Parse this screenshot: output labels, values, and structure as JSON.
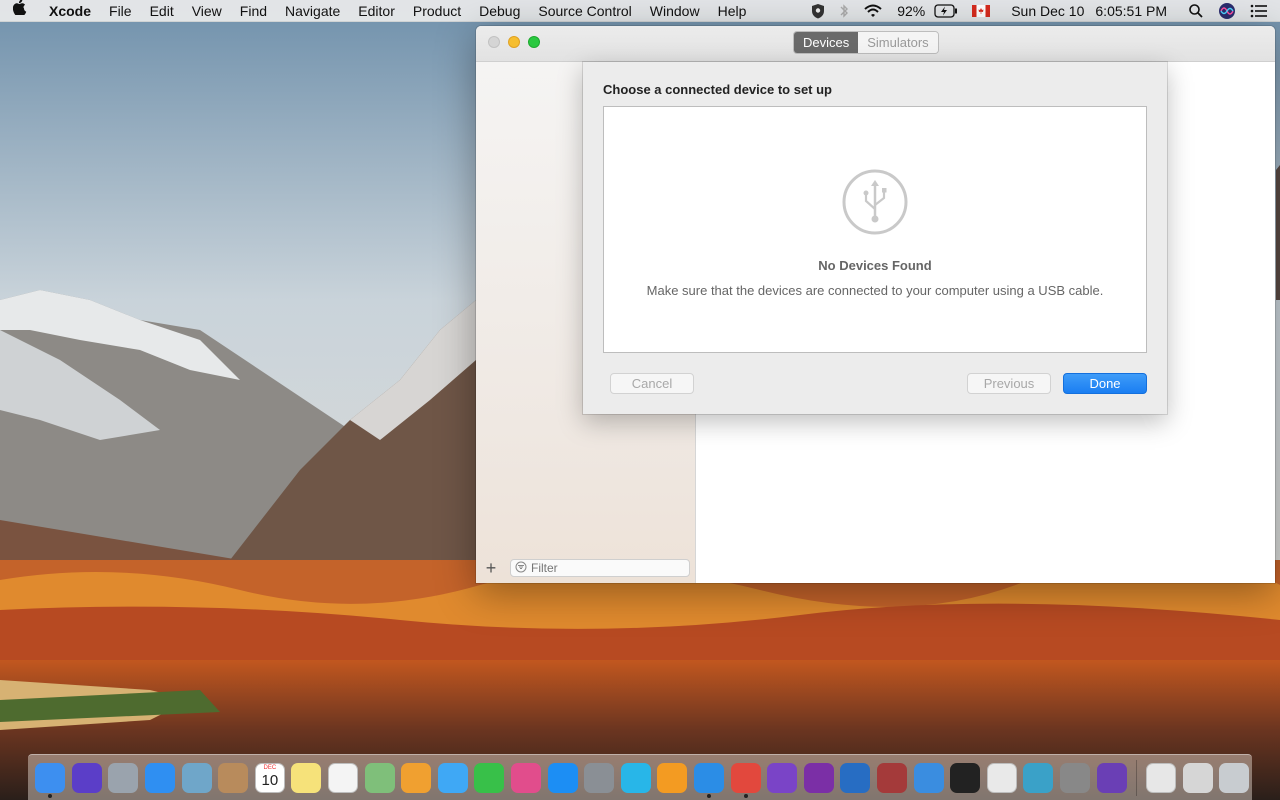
{
  "menubar": {
    "app_name": "Xcode",
    "items": [
      "File",
      "Edit",
      "View",
      "Find",
      "Navigate",
      "Editor",
      "Product",
      "Debug",
      "Source Control",
      "Window",
      "Help"
    ],
    "battery": "92%",
    "date": "Sun Dec 10",
    "time": "6:05:51 PM"
  },
  "window": {
    "tabs": [
      {
        "label": "Devices",
        "active": true
      },
      {
        "label": "Simulators",
        "active": false
      }
    ],
    "filter_placeholder": "Filter"
  },
  "sheet": {
    "title": "Choose a connected device to set up",
    "empty_title": "No Devices Found",
    "empty_message": "Make sure that the devices are connected to your computer using a USB cable.",
    "cancel_label": "Cancel",
    "previous_label": "Previous",
    "done_label": "Done"
  },
  "dock": {
    "calendar_day": "10",
    "calendar_month": "DEC",
    "items": [
      {
        "name": "finder",
        "color": "#3d8ff0"
      },
      {
        "name": "siri",
        "color": "#5b3ec8"
      },
      {
        "name": "launchpad",
        "color": "#9aa3ad"
      },
      {
        "name": "safari",
        "color": "#2f8ff2"
      },
      {
        "name": "preview",
        "color": "#6fa6c9"
      },
      {
        "name": "contacts",
        "color": "#b88b5c"
      },
      {
        "name": "calendar",
        "color": "#ffffff"
      },
      {
        "name": "notes",
        "color": "#f6e27a"
      },
      {
        "name": "reminders",
        "color": "#f4f4f4"
      },
      {
        "name": "maps",
        "color": "#7fbf7a"
      },
      {
        "name": "photos",
        "color": "#f0a030"
      },
      {
        "name": "messages",
        "color": "#3fa8f5"
      },
      {
        "name": "facetime",
        "color": "#38c049"
      },
      {
        "name": "itunes",
        "color": "#e14d8c"
      },
      {
        "name": "app-store",
        "color": "#1c8ef4"
      },
      {
        "name": "system-preferences",
        "color": "#8a8f95"
      },
      {
        "name": "network-app",
        "color": "#28b6e8"
      },
      {
        "name": "ibooks",
        "color": "#f39b22"
      },
      {
        "name": "xcode",
        "color": "#2b8de6"
      },
      {
        "name": "chrome",
        "color": "#e2483d"
      },
      {
        "name": "cinema",
        "color": "#7a44c7"
      },
      {
        "name": "onenote",
        "color": "#7b2fa6"
      },
      {
        "name": "r-app",
        "color": "#276dc3"
      },
      {
        "name": "dictionary",
        "color": "#a43a3a"
      },
      {
        "name": "instruments",
        "color": "#3a8de0"
      },
      {
        "name": "terminal",
        "color": "#222222"
      },
      {
        "name": "textedit",
        "color": "#e9e9e9"
      },
      {
        "name": "sketch-app",
        "color": "#3aa1c8"
      },
      {
        "name": "calculator",
        "color": "#888888"
      },
      {
        "name": "visual-studio",
        "color": "#6a3fb5"
      }
    ],
    "right_items": [
      {
        "name": "stacks-documents",
        "color": "#e7e7e7"
      },
      {
        "name": "stacks-downloads",
        "color": "#d6d6d6"
      },
      {
        "name": "trash",
        "color": "#c8ccd0"
      }
    ],
    "running": [
      "finder",
      "xcode",
      "chrome"
    ]
  }
}
